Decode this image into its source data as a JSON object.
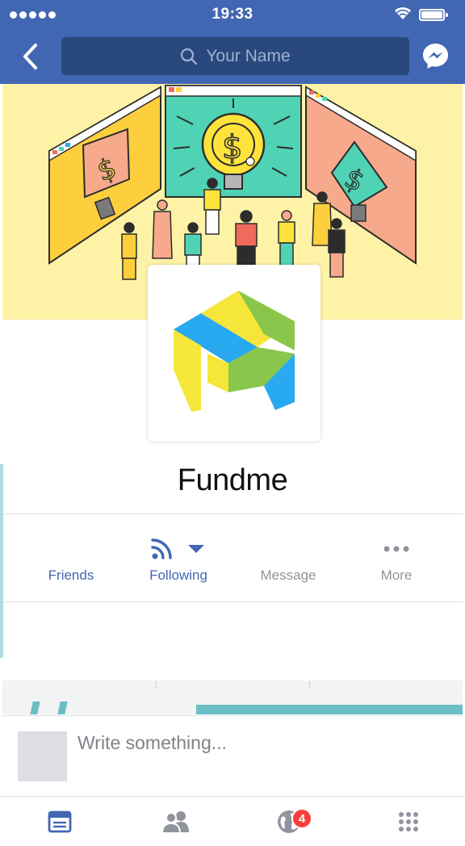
{
  "status_bar": {
    "time": "19:33"
  },
  "header": {
    "search_placeholder": "Your Name",
    "icons": [
      "back-chevron-icon",
      "search-icon",
      "messenger-icon"
    ]
  },
  "cover": {
    "illustration": "people-viewing-lightbulb-dollar-screens",
    "colors": {
      "background": "#fdf2a6",
      "panel_left": "#fdcf3d",
      "panel_center": "#4fd3b4",
      "panel_right": "#f7a98b"
    }
  },
  "profile": {
    "name": "Fundme",
    "logo_colors": [
      "#29a9ef",
      "#f6e63a",
      "#8ac64c"
    ]
  },
  "actions": [
    {
      "label": "Friends",
      "icon": "none",
      "active": true
    },
    {
      "label": "Following",
      "icon": "rss-feed-icon",
      "active": true
    },
    {
      "label": "Message",
      "icon": "none",
      "active": false
    },
    {
      "label": "More",
      "icon": "more-dots-icon",
      "active": false
    }
  ],
  "composer": {
    "placeholder": "Write something..."
  },
  "tabbar": {
    "tabs": [
      {
        "name": "news-feed",
        "icon": "news-feed-icon",
        "active": true
      },
      {
        "name": "friends",
        "icon": "friends-icon",
        "active": false
      },
      {
        "name": "notifications",
        "icon": "globe-icon",
        "badge": "4",
        "active": false
      },
      {
        "name": "menu",
        "icon": "grid-menu-icon",
        "active": false
      }
    ]
  },
  "theme": {
    "brand_blue": "#4267b2",
    "search_bg": "#29487d",
    "badge_red": "#fa3e3e"
  }
}
